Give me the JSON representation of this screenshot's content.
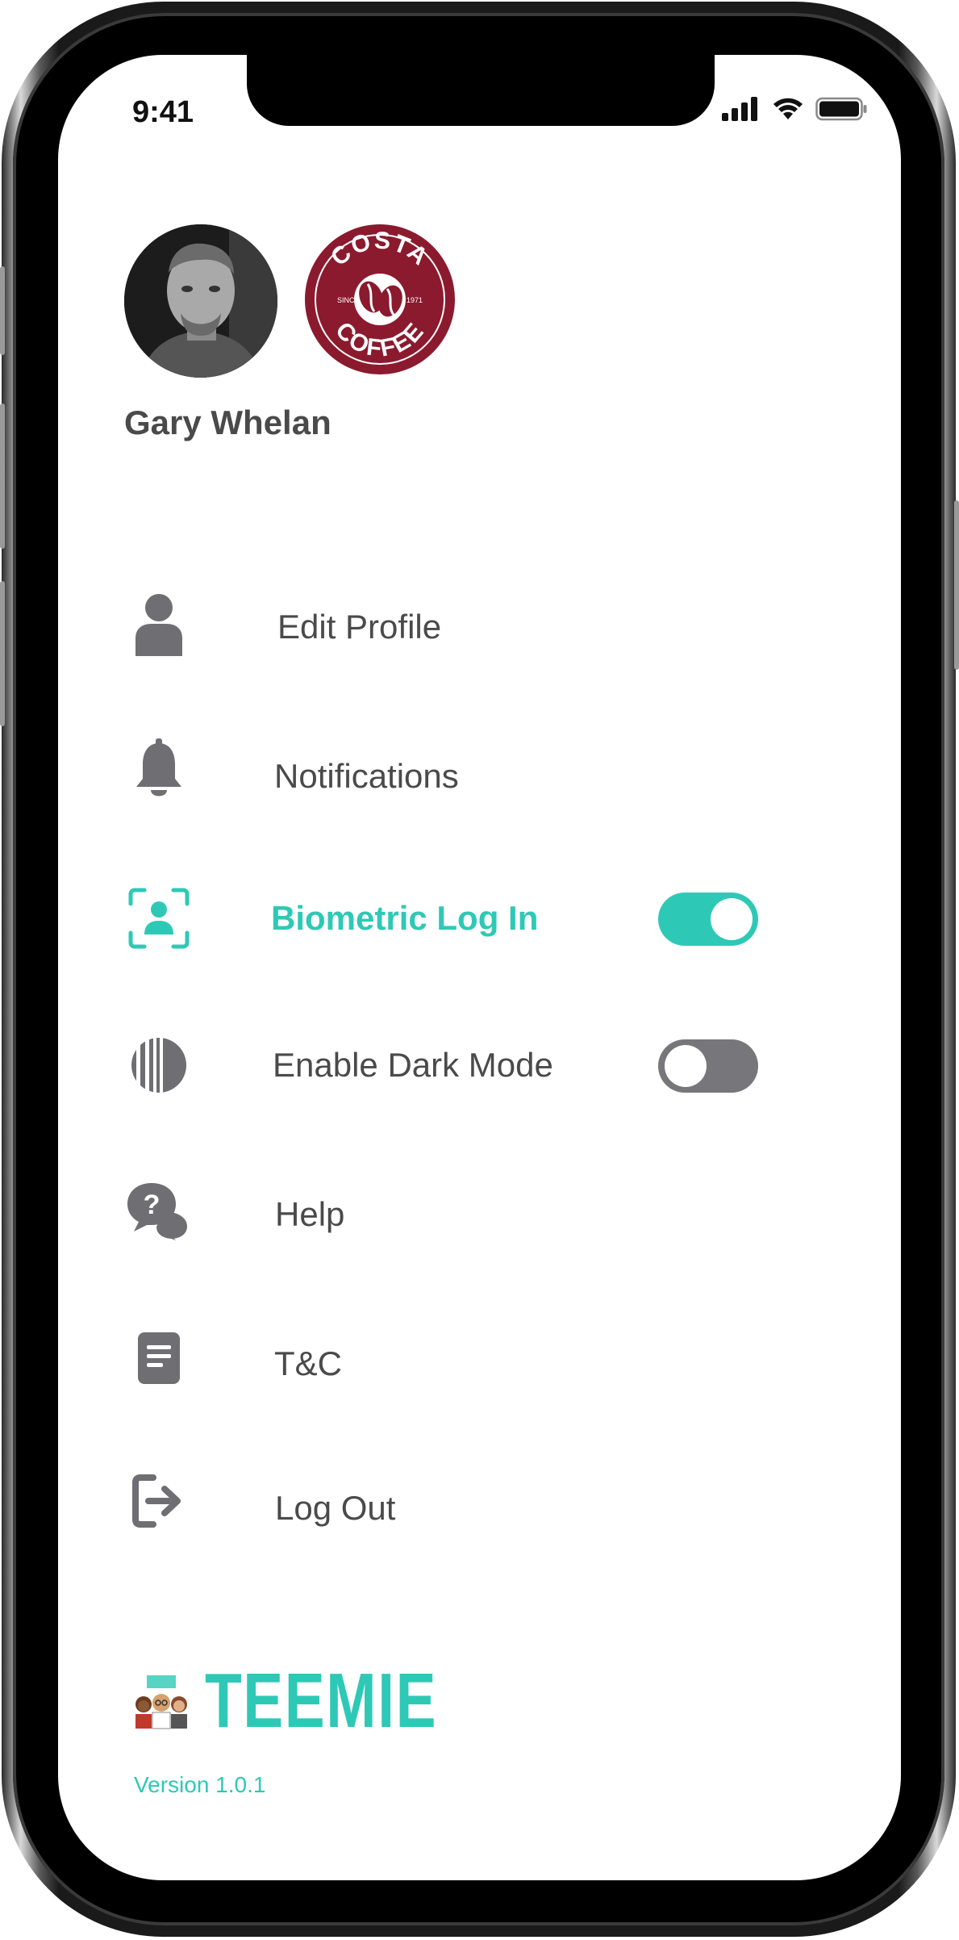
{
  "status_bar": {
    "time": "9:41"
  },
  "profile": {
    "name": "Gary Whelan",
    "brand_logo": {
      "line1": "COSTA",
      "line2": "COFFEE",
      "since": "SINCE",
      "year": "1971"
    }
  },
  "menu": {
    "items": [
      {
        "label": "Edit Profile",
        "icon": "user-icon"
      },
      {
        "label": "Notifications",
        "icon": "bell-icon"
      },
      {
        "label": "Biometric Log In",
        "icon": "face-scan-icon",
        "toggle": true,
        "enabled": true
      },
      {
        "label": "Enable Dark Mode",
        "icon": "dark-mode-icon",
        "toggle": true,
        "enabled": false
      },
      {
        "label": "Help",
        "icon": "help-chat-icon"
      },
      {
        "label": "T&C",
        "icon": "document-icon"
      },
      {
        "label": "Log Out",
        "icon": "logout-icon"
      }
    ]
  },
  "footer": {
    "brand": "TEEMIE",
    "version": "Version 1.0.1"
  },
  "colors": {
    "accent": "#2ec9b6",
    "text": "#4a4a4a",
    "icon": "#6e6e73",
    "toggle_off": "#77777b",
    "brand_red": "#8b1a2e"
  }
}
